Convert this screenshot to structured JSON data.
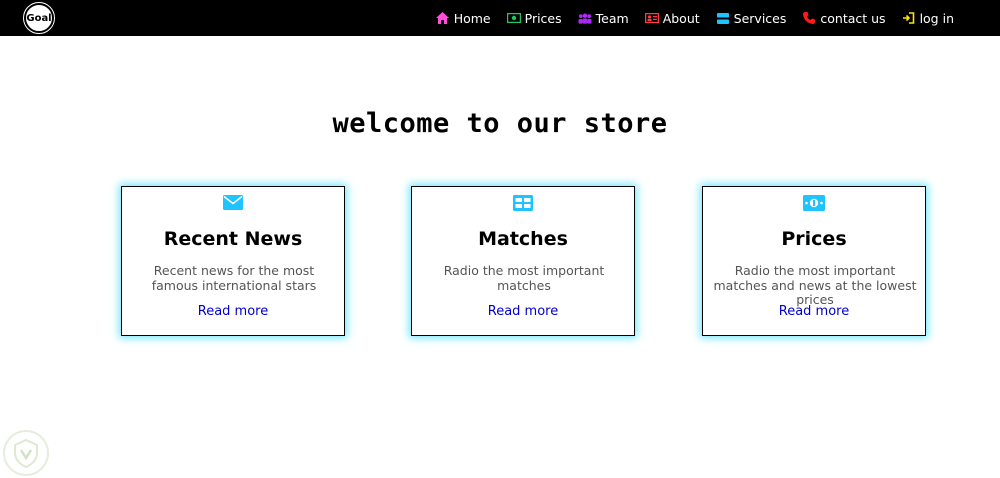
{
  "brand": {
    "logo_text": "Goal"
  },
  "nav": {
    "items": [
      {
        "label": "Home",
        "icon": "home-icon",
        "color": "#ff4fd8"
      },
      {
        "label": "Prices",
        "icon": "money-icon",
        "color": "#22c55e"
      },
      {
        "label": "Team",
        "icon": "users-icon",
        "color": "#b026ff"
      },
      {
        "label": "About",
        "icon": "id-card-icon",
        "color": "#ff3b3b"
      },
      {
        "label": "Services",
        "icon": "server-icon",
        "color": "#1fc3ff"
      },
      {
        "label": "contact us",
        "icon": "phone-icon",
        "color": "#ff1a1a"
      },
      {
        "label": "log in",
        "icon": "sign-in-icon",
        "color": "#ffe600"
      }
    ]
  },
  "main": {
    "heading": "welcome to our store"
  },
  "cards": [
    {
      "icon": "envelope-icon",
      "title": "Recent News",
      "text": "Recent news for the most famous international stars",
      "link": "Read more"
    },
    {
      "icon": "grid-icon",
      "title": "Matches",
      "text": "Radio the most important matches",
      "link": "Read more"
    },
    {
      "icon": "money-icon",
      "title": "Prices",
      "text": "Radio the most important matches and news at the lowest prices",
      "link": "Read more"
    }
  ],
  "colors": {
    "accent": "#1fc3ff",
    "glow": "#6fe6ff",
    "link": "#0000cc",
    "navbar": "#000000"
  }
}
